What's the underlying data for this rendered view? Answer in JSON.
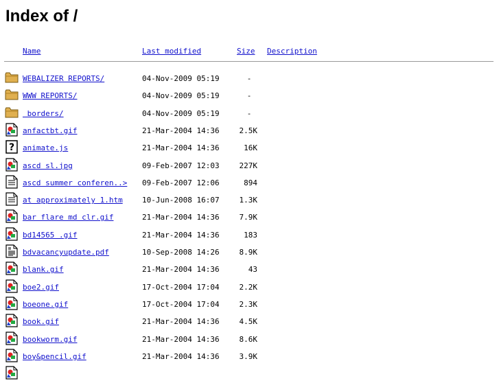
{
  "page": {
    "title": "Index of /"
  },
  "columns": {
    "name": "Name",
    "last_modified": "Last modified",
    "size": "Size",
    "description": "Description"
  },
  "entries": [
    {
      "icon": "folder-icon",
      "name": "WEBALIZER REPORTS/",
      "modified": "04-Nov-2009 05:19",
      "size": "-"
    },
    {
      "icon": "folder-icon",
      "name": "WWW REPORTS/",
      "modified": "04-Nov-2009 05:19",
      "size": "-"
    },
    {
      "icon": "folder-icon",
      "name": " borders/",
      "modified": "04-Nov-2009 05:19",
      "size": "-"
    },
    {
      "icon": "image-file-icon",
      "name": "anfactbt.gif",
      "modified": "21-Mar-2004 14:36",
      "size": "2.5K"
    },
    {
      "icon": "unknown-file-icon",
      "name": "animate.js",
      "modified": "21-Mar-2004 14:36",
      "size": "16K"
    },
    {
      "icon": "image-file-icon",
      "name": "ascd sl.jpg",
      "modified": "09-Feb-2007 12:03",
      "size": "227K"
    },
    {
      "icon": "text-file-icon",
      "name": "ascd summer conferen..>",
      "modified": "09-Feb-2007 12:06",
      "size": "894"
    },
    {
      "icon": "text-file-icon",
      "name": "at approximately 1.htm",
      "modified": "10-Jun-2008 16:07",
      "size": "1.3K"
    },
    {
      "icon": "image-file-icon",
      "name": "bar flare md clr.gif",
      "modified": "21-Mar-2004 14:36",
      "size": "7.9K"
    },
    {
      "icon": "image-file-icon",
      "name": "bd14565 .gif",
      "modified": "21-Mar-2004 14:36",
      "size": "183"
    },
    {
      "icon": "layout-file-icon",
      "name": "bdvacancyupdate.pdf",
      "modified": "10-Sep-2008 14:26",
      "size": "8.9K"
    },
    {
      "icon": "image-file-icon",
      "name": "blank.gif",
      "modified": "21-Mar-2004 14:36",
      "size": "43"
    },
    {
      "icon": "image-file-icon",
      "name": "boe2.gif",
      "modified": "17-Oct-2004 17:04",
      "size": "2.2K"
    },
    {
      "icon": "image-file-icon",
      "name": "boeone.gif",
      "modified": "17-Oct-2004 17:04",
      "size": "2.3K"
    },
    {
      "icon": "image-file-icon",
      "name": "book.gif",
      "modified": "21-Mar-2004 14:36",
      "size": "4.5K"
    },
    {
      "icon": "image-file-icon",
      "name": "bookworm.gif",
      "modified": "21-Mar-2004 14:36",
      "size": "8.6K"
    },
    {
      "icon": "image-file-icon",
      "name": "boy&pencil.gif",
      "modified": "21-Mar-2004 14:36",
      "size": "3.9K"
    },
    {
      "icon": "image-file-icon",
      "name": "",
      "modified": "",
      "size": ""
    }
  ]
}
